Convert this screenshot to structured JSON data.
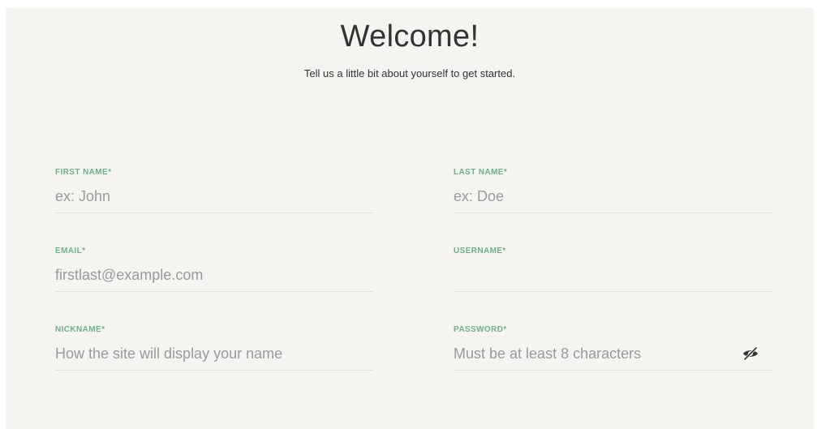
{
  "header": {
    "title": "Welcome!",
    "subtitle": "Tell us a little bit about yourself to get started."
  },
  "form": {
    "first_name": {
      "label": "FIRST NAME*",
      "placeholder": "ex: John",
      "value": ""
    },
    "last_name": {
      "label": "LAST NAME*",
      "placeholder": "ex: Doe",
      "value": ""
    },
    "email": {
      "label": "EMAIL*",
      "placeholder": "firstlast@example.com",
      "value": ""
    },
    "username": {
      "label": "USERNAME*",
      "placeholder": "",
      "value": ""
    },
    "nickname": {
      "label": "NICKNAME*",
      "placeholder": "How the site will display your name",
      "value": ""
    },
    "password": {
      "label": "PASSWORD*",
      "placeholder": "Must be at least 8 characters",
      "value": "",
      "toggle_icon": "eye-slash-icon"
    }
  },
  "colors": {
    "background": "#f5f4f1",
    "label": "#6fb087",
    "text": "#333333",
    "placeholder": "#9a9a9a",
    "underline": "#e2e1dd"
  }
}
